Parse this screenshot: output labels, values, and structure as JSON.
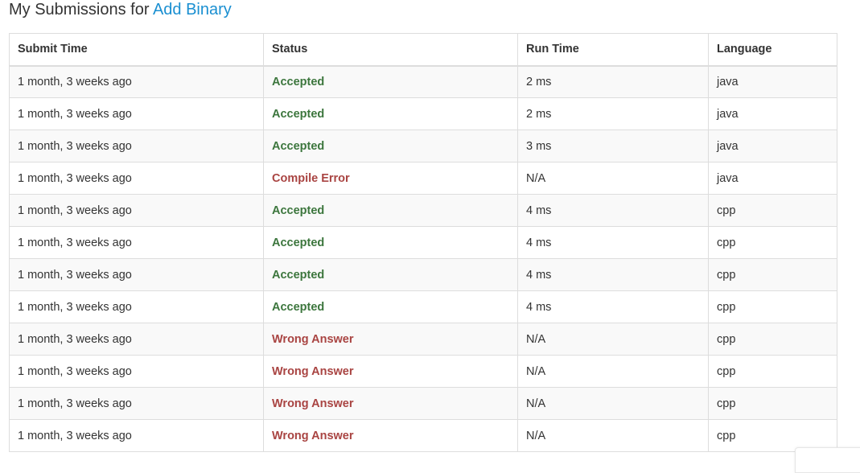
{
  "header": {
    "prefix": "My Submissions for",
    "problem_link": "Add Binary"
  },
  "table": {
    "columns": [
      "Submit Time",
      "Status",
      "Run Time",
      "Language"
    ],
    "rows": [
      {
        "submit_time": "1 month, 3 weeks ago",
        "status": "Accepted",
        "status_type": "accepted",
        "run_time": "2 ms",
        "language": "java"
      },
      {
        "submit_time": "1 month, 3 weeks ago",
        "status": "Accepted",
        "status_type": "accepted",
        "run_time": "2 ms",
        "language": "java"
      },
      {
        "submit_time": "1 month, 3 weeks ago",
        "status": "Accepted",
        "status_type": "accepted",
        "run_time": "3 ms",
        "language": "java"
      },
      {
        "submit_time": "1 month, 3 weeks ago",
        "status": "Compile Error",
        "status_type": "error",
        "run_time": "N/A",
        "language": "java"
      },
      {
        "submit_time": "1 month, 3 weeks ago",
        "status": "Accepted",
        "status_type": "accepted",
        "run_time": "4 ms",
        "language": "cpp"
      },
      {
        "submit_time": "1 month, 3 weeks ago",
        "status": "Accepted",
        "status_type": "accepted",
        "run_time": "4 ms",
        "language": "cpp"
      },
      {
        "submit_time": "1 month, 3 weeks ago",
        "status": "Accepted",
        "status_type": "accepted",
        "run_time": "4 ms",
        "language": "cpp"
      },
      {
        "submit_time": "1 month, 3 weeks ago",
        "status": "Accepted",
        "status_type": "accepted",
        "run_time": "4 ms",
        "language": "cpp"
      },
      {
        "submit_time": "1 month, 3 weeks ago",
        "status": "Wrong Answer",
        "status_type": "error",
        "run_time": "N/A",
        "language": "cpp"
      },
      {
        "submit_time": "1 month, 3 weeks ago",
        "status": "Wrong Answer",
        "status_type": "error",
        "run_time": "N/A",
        "language": "cpp"
      },
      {
        "submit_time": "1 month, 3 weeks ago",
        "status": "Wrong Answer",
        "status_type": "error",
        "run_time": "N/A",
        "language": "cpp"
      },
      {
        "submit_time": "1 month, 3 weeks ago",
        "status": "Wrong Answer",
        "status_type": "error",
        "run_time": "N/A",
        "language": "cpp"
      }
    ]
  },
  "colors": {
    "link": "#1a8fd1",
    "accepted": "#3c763d",
    "error": "#a94442",
    "stripe": "#f9f9f9",
    "border": "#dddddd"
  }
}
